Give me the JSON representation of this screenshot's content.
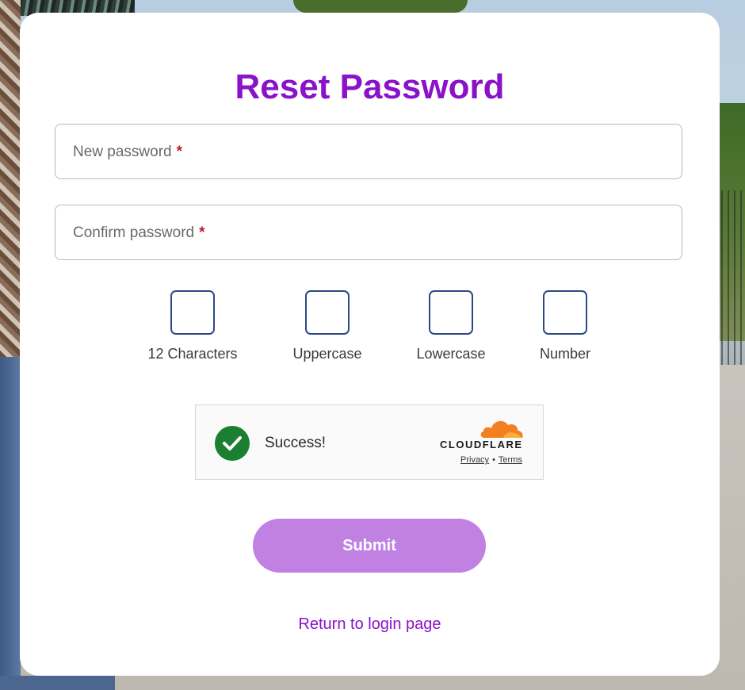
{
  "form": {
    "title": "Reset Password",
    "new_password_label": "New password",
    "confirm_password_label": "Confirm password",
    "required_marker": "*",
    "requirements": [
      {
        "label": "12 Characters",
        "checked": false
      },
      {
        "label": "Uppercase",
        "checked": false
      },
      {
        "label": "Lowercase",
        "checked": false
      },
      {
        "label": "Number",
        "checked": false
      }
    ],
    "submit_label": "Submit",
    "return_link": "Return to login page"
  },
  "captcha": {
    "status": "Success!",
    "status_icon": "checkmark-circle-icon",
    "brand": "CLOUDFLARE",
    "privacy_link": "Privacy",
    "separator": "•",
    "terms_link": "Terms"
  },
  "colors": {
    "accent": "#8a12c9",
    "submit_bg": "#c181e3",
    "success": "#1b7f32",
    "checkbox_border": "#2d4a84",
    "required": "#c0182a",
    "cloudflare_orange": "#f38020"
  }
}
